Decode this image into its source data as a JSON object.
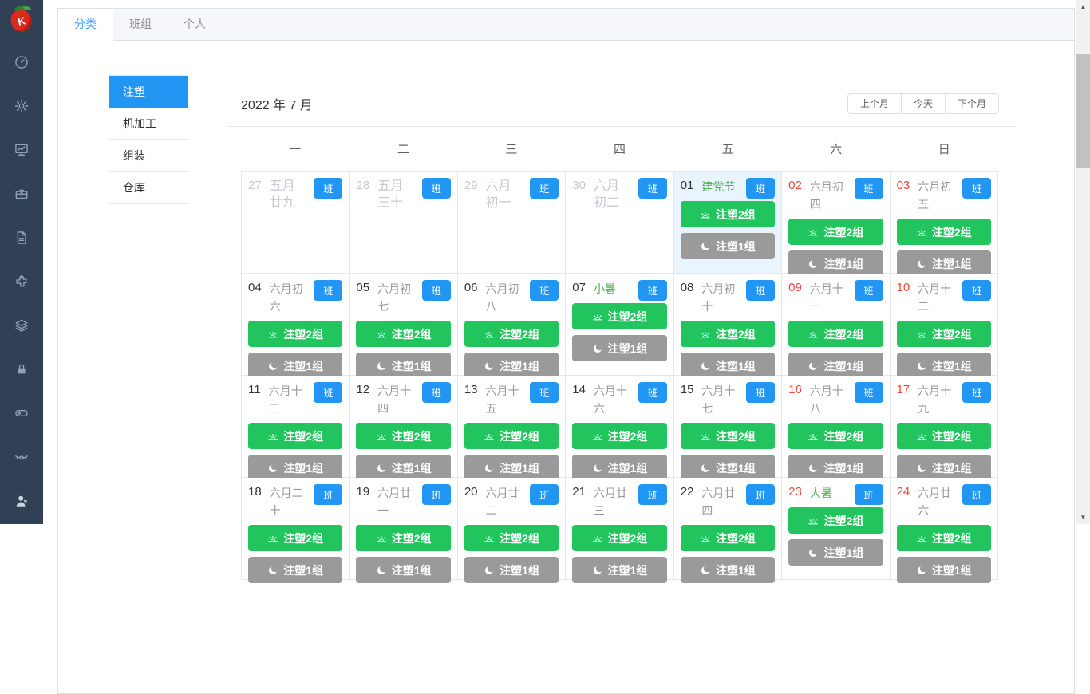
{
  "app": {
    "logo_letter": "K"
  },
  "sidebar": {
    "icons": [
      "dashboard-icon",
      "settings-icon",
      "report-chart-icon",
      "toolbox-icon",
      "document-icon",
      "plugin-icon",
      "layers-icon",
      "lock-icon",
      "toggle-icon",
      "eye-closed-icon",
      "user-admin-icon"
    ]
  },
  "tabs": [
    {
      "key": "category",
      "label": "分类",
      "active": true
    },
    {
      "key": "group",
      "label": "班组",
      "active": false
    },
    {
      "key": "personal",
      "label": "个人",
      "active": false
    }
  ],
  "categories": [
    {
      "key": "injection",
      "label": "注塑",
      "active": true
    },
    {
      "key": "machining",
      "label": "机加工",
      "active": false
    },
    {
      "key": "assembly",
      "label": "组装",
      "active": false
    },
    {
      "key": "warehouse",
      "label": "仓库",
      "active": false
    }
  ],
  "calendar": {
    "title": "2022 年 7 月",
    "nav": {
      "prev": "上个月",
      "today": "今天",
      "next": "下个月"
    },
    "weekdays": [
      "一",
      "二",
      "三",
      "四",
      "五",
      "六",
      "日"
    ],
    "badge_label": "班",
    "shift_labels": {
      "day": "注塑2组",
      "night": "注塑1组"
    },
    "cells": [
      {
        "date": "27",
        "lunar": "五月廿九",
        "other_month": true,
        "shifts": []
      },
      {
        "date": "28",
        "lunar": "五月三十",
        "other_month": true,
        "shifts": []
      },
      {
        "date": "29",
        "lunar": "六月初一",
        "other_month": true,
        "shifts": []
      },
      {
        "date": "30",
        "lunar": "六月初二",
        "other_month": true,
        "shifts": []
      },
      {
        "date": "01",
        "lunar": "建党节",
        "festival": true,
        "today": true,
        "shifts": [
          "day",
          "night"
        ]
      },
      {
        "date": "02",
        "lunar": "六月初四",
        "weekend": true,
        "shifts": [
          "day",
          "night"
        ]
      },
      {
        "date": "03",
        "lunar": "六月初五",
        "weekend": true,
        "shifts": [
          "day",
          "night"
        ]
      },
      {
        "date": "04",
        "lunar": "六月初六",
        "shifts": [
          "day",
          "night"
        ]
      },
      {
        "date": "05",
        "lunar": "六月初七",
        "shifts": [
          "day",
          "night"
        ]
      },
      {
        "date": "06",
        "lunar": "六月初八",
        "shifts": [
          "day",
          "night"
        ]
      },
      {
        "date": "07",
        "lunar": "小暑",
        "festival": true,
        "shifts": [
          "day",
          "night"
        ]
      },
      {
        "date": "08",
        "lunar": "六月初十",
        "shifts": [
          "day",
          "night"
        ]
      },
      {
        "date": "09",
        "lunar": "六月十一",
        "weekend": true,
        "shifts": [
          "day",
          "night"
        ]
      },
      {
        "date": "10",
        "lunar": "六月十二",
        "weekend": true,
        "shifts": [
          "day",
          "night"
        ]
      },
      {
        "date": "11",
        "lunar": "六月十三",
        "shifts": [
          "day",
          "night"
        ]
      },
      {
        "date": "12",
        "lunar": "六月十四",
        "shifts": [
          "day",
          "night"
        ]
      },
      {
        "date": "13",
        "lunar": "六月十五",
        "shifts": [
          "day",
          "night"
        ]
      },
      {
        "date": "14",
        "lunar": "六月十六",
        "shifts": [
          "day",
          "night"
        ]
      },
      {
        "date": "15",
        "lunar": "六月十七",
        "shifts": [
          "day",
          "night"
        ]
      },
      {
        "date": "16",
        "lunar": "六月十八",
        "weekend": true,
        "shifts": [
          "day",
          "night"
        ]
      },
      {
        "date": "17",
        "lunar": "六月十九",
        "weekend": true,
        "shifts": [
          "day",
          "night"
        ]
      },
      {
        "date": "18",
        "lunar": "六月二十",
        "shifts": [
          "day",
          "night"
        ]
      },
      {
        "date": "19",
        "lunar": "六月廿一",
        "shifts": [
          "day",
          "night"
        ]
      },
      {
        "date": "20",
        "lunar": "六月廿二",
        "shifts": [
          "day",
          "night"
        ]
      },
      {
        "date": "21",
        "lunar": "六月廿三",
        "shifts": [
          "day",
          "night"
        ]
      },
      {
        "date": "22",
        "lunar": "六月廿四",
        "shifts": [
          "day",
          "night"
        ]
      },
      {
        "date": "23",
        "lunar": "大暑",
        "festival": true,
        "weekend": true,
        "shifts": [
          "day",
          "night"
        ]
      },
      {
        "date": "24",
        "lunar": "六月廿六",
        "weekend": true,
        "shifts": [
          "day",
          "night"
        ]
      }
    ]
  },
  "colors": {
    "accent_blue": "#2196f3",
    "tab_blue": "#409eff",
    "shift_day_green": "#21c45d",
    "shift_night_gray": "#9a9a9a",
    "festival_green": "#4caf50",
    "weekend_red": "#f44336",
    "today_bg": "#eaf4fe",
    "sidebar_bg": "#304156"
  }
}
